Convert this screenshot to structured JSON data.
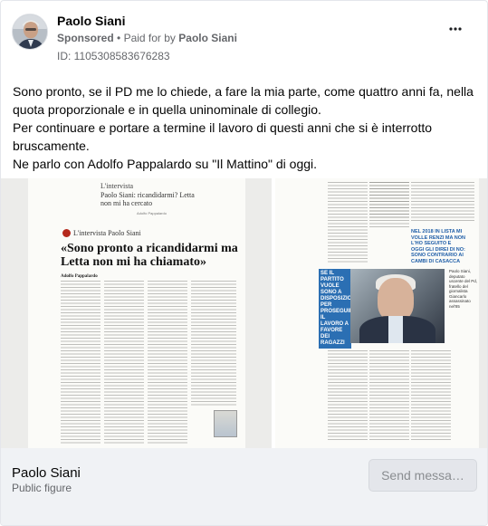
{
  "post": {
    "author": "Paolo Siani",
    "sponsored": "Sponsored",
    "paid_for_prefix": "Paid for by",
    "paid_for_name": "Paolo Siani",
    "ad_id": "ID: 1105308583676283",
    "more_icon": "more-horizontal-icon"
  },
  "body": {
    "paragraphs": [
      "Sono pronto, se il PD me lo chiede, a fare la mia parte, come quattro anni fa, nella quota proporzionale e in quella uninominale di collegio.",
      "Per continuare e portare a termine il lavoro di questi anni che si è interrotto bruscamente.",
      "Ne parlo con Adolfo Pappalardo su \"Il Mattino\" di oggi."
    ]
  },
  "gallery": {
    "newspaper_left": {
      "kicker": "L'intervista",
      "kicker_sub": "Paolo Siani: ricandidarmi? Letta non mi ha cercato",
      "signature": "Adolfo Pappalardo",
      "section_label": "L'intervista Paolo Siani",
      "headline": "«Sono pronto a ricandidarmi ma Letta non mi ha chiamato»",
      "byline": "Adolfo Pappalardo"
    },
    "newspaper_right": {
      "caption": "SE IL PARTITO VUOLE SONO A DISPOSIZIONE PER PROSEGUIRE IL LAVORO A FAVORE DEI RAGAZZI",
      "quote": "NEL 2018 IN LISTA MI VOLLE RENZI MA NON L'HO SEGUITO E OGGI GLI DIREI DI NO: SONO CONTRARIO AI CAMBI DI CASACCA",
      "side_note": "Paolo Siani, deputato uscente del Pd, fratello del giornalista Giancarlo assassinato nel'85"
    },
    "next_icon": "chevron-right-icon"
  },
  "footer": {
    "name": "Paolo Siani",
    "subtitle": "Public figure",
    "send_label": "Send messa…"
  },
  "colors": {
    "accent_red": "#b5291d",
    "caption_blue": "#2b6fb3",
    "footer_bg": "#f0f2f5"
  }
}
